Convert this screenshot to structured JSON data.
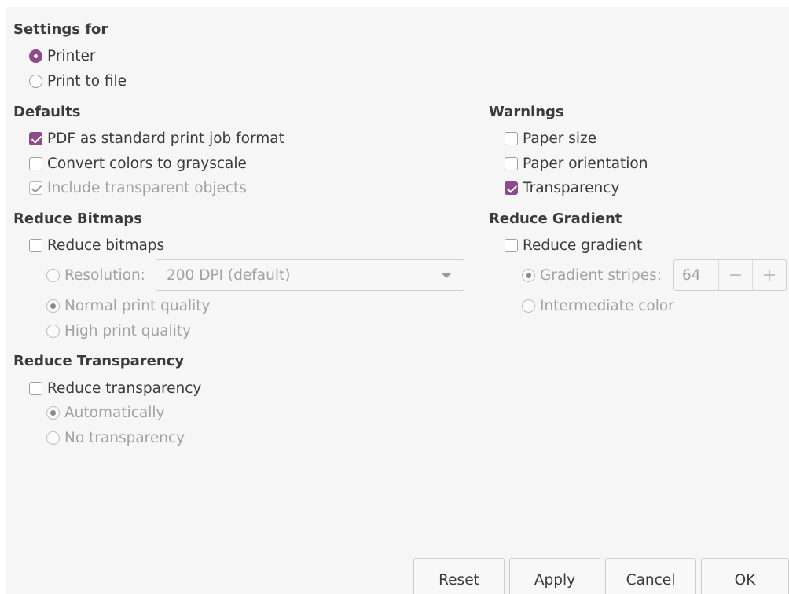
{
  "settings_for": {
    "heading": "Settings for",
    "printer": "Printer",
    "print_to_file": "Print to file",
    "selected": "Printer"
  },
  "defaults": {
    "heading": "Defaults",
    "pdf_format": "PDF as standard print job format",
    "pdf_format_checked": true,
    "grayscale": "Convert colors to grayscale",
    "grayscale_checked": false,
    "transparent_objects": "Include transparent objects",
    "transparent_objects_checked": true,
    "transparent_objects_enabled": false
  },
  "warnings": {
    "heading": "Warnings",
    "paper_size": "Paper size",
    "paper_size_checked": false,
    "paper_orientation": "Paper orientation",
    "paper_orientation_checked": false,
    "transparency": "Transparency",
    "transparency_checked": true
  },
  "reduce_bitmaps": {
    "heading": "Reduce Bitmaps",
    "checkbox": "Reduce bitmaps",
    "checked": false,
    "resolution_label": "Resolution:",
    "resolution_value": "200 DPI (default)",
    "normal_quality": "Normal print quality",
    "high_quality": "High print quality",
    "selected": "Normal print quality"
  },
  "reduce_gradient": {
    "heading": "Reduce Gradient",
    "checkbox": "Reduce gradient",
    "checked": false,
    "stripes_label": "Gradient stripes:",
    "stripes_value": "64",
    "intermediate": "Intermediate color",
    "selected": "Gradient stripes:"
  },
  "reduce_transparency": {
    "heading": "Reduce Transparency",
    "checkbox": "Reduce transparency",
    "checked": false,
    "automatically": "Automatically",
    "no_transparency": "No transparency",
    "selected": "Automatically"
  },
  "buttons": {
    "reset": "Reset",
    "apply": "Apply",
    "cancel": "Cancel",
    "ok": "OK"
  },
  "colors": {
    "accent": "#8e4a8a",
    "background": "#f6f6f6",
    "text": "#3a3a3a",
    "disabled_text": "#a2a2a2"
  }
}
